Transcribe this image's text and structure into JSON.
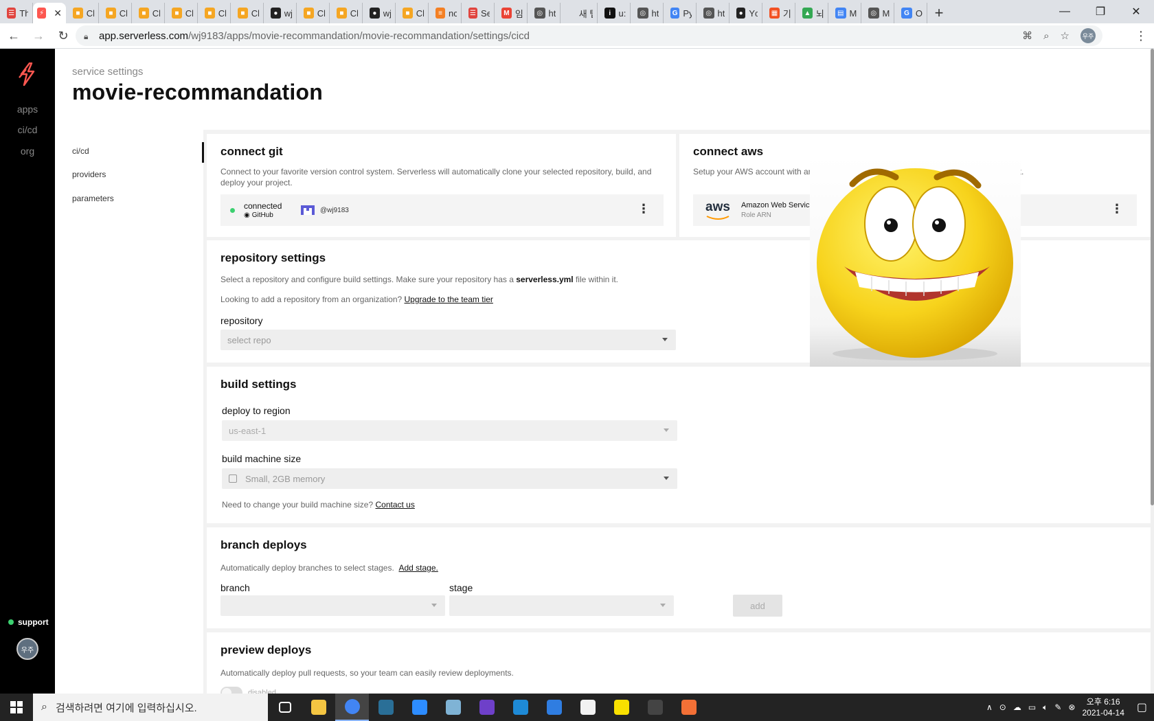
{
  "browser": {
    "tabs": [
      {
        "label": "Th",
        "color": "#e0443e",
        "glyph": "☰"
      },
      {
        "label": "",
        "color": "#fd5750",
        "glyph": "⚡",
        "active": true
      },
      {
        "label": "Cl",
        "color": "#f5a623",
        "glyph": "■"
      },
      {
        "label": "Cl",
        "color": "#f5a623",
        "glyph": "■"
      },
      {
        "label": "Cl",
        "color": "#f5a623",
        "glyph": "■"
      },
      {
        "label": "Cl",
        "color": "#f5a623",
        "glyph": "■"
      },
      {
        "label": "Cl",
        "color": "#f5a623",
        "glyph": "■"
      },
      {
        "label": "Cl",
        "color": "#f5a623",
        "glyph": "■"
      },
      {
        "label": "wj",
        "color": "#222222",
        "glyph": "●"
      },
      {
        "label": "Cl",
        "color": "#f5a623",
        "glyph": "■"
      },
      {
        "label": "Cl",
        "color": "#f5a623",
        "glyph": "■"
      },
      {
        "label": "wj",
        "color": "#222222",
        "glyph": "●"
      },
      {
        "label": "Cl",
        "color": "#f5a623",
        "glyph": "■"
      },
      {
        "label": "nc",
        "color": "#f48024",
        "glyph": "≡"
      },
      {
        "label": "Se",
        "color": "#e0443e",
        "glyph": "☰"
      },
      {
        "label": "임",
        "color": "#ea4335",
        "glyph": "M"
      },
      {
        "label": "ht",
        "color": "#555555",
        "glyph": "◎"
      },
      {
        "label": "새 탭",
        "color": "#dee1e6",
        "glyph": ""
      },
      {
        "label": "u:",
        "color": "#111111",
        "glyph": "i"
      },
      {
        "label": "ht",
        "color": "#555555",
        "glyph": "◎"
      },
      {
        "label": "Py",
        "color": "#4285f4",
        "glyph": "G"
      },
      {
        "label": "ht",
        "color": "#555555",
        "glyph": "◎"
      },
      {
        "label": "Yc",
        "color": "#222222",
        "glyph": "●"
      },
      {
        "label": "기",
        "color": "#f25022",
        "glyph": "▦"
      },
      {
        "label": "뇌",
        "color": "#34a853",
        "glyph": "▲"
      },
      {
        "label": "M",
        "color": "#4285f4",
        "glyph": "▤"
      },
      {
        "label": "M",
        "color": "#555555",
        "glyph": "◎"
      },
      {
        "label": "O",
        "color": "#4285f4",
        "glyph": "G"
      }
    ],
    "new_tab": "+",
    "url_host": "app.serverless.com",
    "url_path": "/wj9183/apps/movie-recommandation/movie-recommandation/settings/cicd",
    "profile_initials": "우주"
  },
  "leftnav": {
    "items": [
      {
        "label": "apps",
        "active": true
      },
      {
        "label": "ci/cd",
        "active": false
      },
      {
        "label": "org",
        "active": false
      }
    ],
    "support_label": "support",
    "avatar_initials": "우주",
    "logo_color": "#fd5750"
  },
  "header": {
    "breadcrumb": "service settings",
    "title": "movie-recommandation"
  },
  "subnav": {
    "items": [
      "ci/cd",
      "providers",
      "parameters"
    ]
  },
  "connect_git": {
    "title": "connect git",
    "description": "Connect to your favorite version control system. Serverless will automatically clone your selected repository, build, and deploy your project.",
    "status": "connected",
    "provider": "GitHub",
    "account": "@wj9183"
  },
  "connect_aws": {
    "title": "connect aws",
    "description_start": "Setup your AWS account with an IAM",
    "description_end": "nt.",
    "provider_name": "Amazon Web Service",
    "provider_sub": "Role ARN",
    "aws_logo": "aws"
  },
  "repository_settings": {
    "title": "repository settings",
    "desc_prefix": "Select a repository and configure build settings. Make sure your repository has a ",
    "desc_file": "serverless.yml",
    "desc_suffix": " file within it.",
    "org_prefix": "Looking to add a repository from an organization? ",
    "org_link": "Upgrade to the team tier",
    "repo_label": "repository",
    "repo_placeholder": "select repo"
  },
  "build_settings": {
    "title": "build settings",
    "region_label": "deploy to region",
    "region_value": "us-east-1",
    "machine_label": "build machine size",
    "machine_value": "Small, 2GB memory",
    "help_prefix": "Need to change your build machine size? ",
    "help_link": "Contact us"
  },
  "branch_deploys": {
    "title": "branch deploys",
    "desc": "Automatically deploy branches to select stages.",
    "add_stage_link": "Add stage.",
    "branch_label": "branch",
    "stage_label": "stage",
    "add_button": "add"
  },
  "preview_deploys": {
    "title": "preview deploys",
    "desc": "Automatically deploy pull requests, so your team can easily review deployments.",
    "toggle_label": "disabled"
  },
  "taskbar": {
    "search_placeholder": "검색하려면 여기에 입력하십시오.",
    "apps": [
      {
        "name": "task-view-icon",
        "color": "#ffffff"
      },
      {
        "name": "file-explorer-icon",
        "color": "#f4c542"
      },
      {
        "name": "chrome-icon",
        "color": "#4285f4"
      },
      {
        "name": "mysql-workbench-icon",
        "color": "#2a6f97"
      },
      {
        "name": "zoom-icon",
        "color": "#2d8cff"
      },
      {
        "name": "notepad-icon",
        "color": "#7fb3d5"
      },
      {
        "name": "github-desktop-icon",
        "color": "#6e40c9"
      },
      {
        "name": "vscode-icon",
        "color": "#1e8ad6"
      },
      {
        "name": "remote-desktop-icon",
        "color": "#2f7de1"
      },
      {
        "name": "powerpoint-icon",
        "color": "#f2f2f2"
      },
      {
        "name": "kakaotalk-icon",
        "color": "#f9e000"
      },
      {
        "name": "terminal-icon",
        "color": "#444444"
      },
      {
        "name": "postman-icon",
        "color": "#f37036"
      }
    ],
    "time": "오후 6:16",
    "date": "2021-04-14"
  }
}
